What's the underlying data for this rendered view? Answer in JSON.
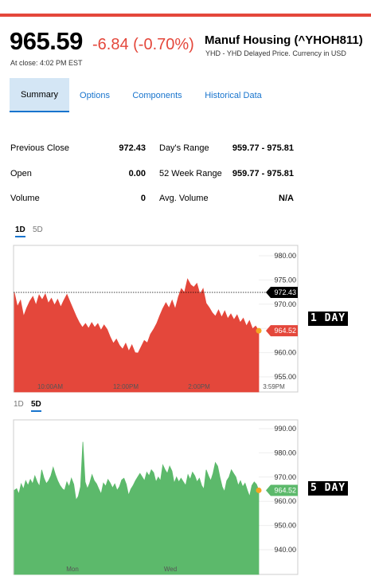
{
  "quote": {
    "price": "965.59",
    "change": "-6.84 (-0.70%)",
    "at_close": "At close: 4:02 PM EST",
    "name": "Manuf Housing (^YHOH811)",
    "subtitle": "YHD - YHD Delayed Price. Currency in USD"
  },
  "tabs": [
    "Summary",
    "Options",
    "Components",
    "Historical Data"
  ],
  "stats": [
    {
      "label": "Previous Close",
      "value": "972.43",
      "label2": "Day's Range",
      "value2": "959.77 - 975.81"
    },
    {
      "label": "Open",
      "value": "0.00",
      "label2": "52 Week Range",
      "value2": "959.77 - 975.81"
    },
    {
      "label": "Volume",
      "value": "0",
      "label2": "Avg. Volume",
      "value2": "N/A"
    }
  ],
  "chart1": {
    "range_tabs": [
      "1D",
      "5D"
    ],
    "side_label": "1 DAY"
  },
  "chart2": {
    "range_tabs": [
      "1D",
      "5D"
    ],
    "side_label": "5 DAY"
  },
  "colors": {
    "accent": "#1874cd",
    "down": "#e4473b",
    "up": "#5cb96b"
  },
  "chart_data": [
    {
      "type": "area",
      "title": "1D",
      "y_ticks": [
        "980.00",
        "975.00",
        "970.00",
        "965.00",
        "960.00",
        "955.00"
      ],
      "ylim": [
        955,
        980
      ],
      "x_ticks": [
        "10:00AM",
        "12:00PM",
        "2:00PM",
        "3:59PM"
      ],
      "reference_line": {
        "label": "972.43",
        "value": 972.43
      },
      "last_price": {
        "label": "964.52",
        "value": 964.52
      },
      "color": "#e4473b",
      "values": [
        972.4,
        969.5,
        970.8,
        967.5,
        969.2,
        970.6,
        971.6,
        969.8,
        971.9,
        970.9,
        972.1,
        970.2,
        971.2,
        969.8,
        971.0,
        969.4,
        970.8,
        972.0,
        970.5,
        969.0,
        967.5,
        966.2,
        965.2,
        966.0,
        965.0,
        966.2,
        965.2,
        966.0,
        964.6,
        965.7,
        964.8,
        963.2,
        961.9,
        962.8,
        961.5,
        960.7,
        961.9,
        960.3,
        961.6,
        960.0,
        959.9,
        961.2,
        962.5,
        962.0,
        963.8,
        964.8,
        966.0,
        967.6,
        969.1,
        970.3,
        969.2,
        970.8,
        969.0,
        971.5,
        973.2,
        972.4,
        975.2,
        974.0,
        973.5,
        974.3,
        972.0,
        973.2,
        970.2,
        969.3,
        968.2,
        967.5,
        968.8,
        967.3,
        968.6,
        967.0,
        968.0,
        966.8,
        967.8,
        966.2,
        967.1,
        965.5,
        966.6,
        964.9,
        965.5,
        964.52
      ]
    },
    {
      "type": "area",
      "title": "5D",
      "y_ticks": [
        "990.00",
        "980.00",
        "970.00",
        "960.00",
        "950.00",
        "940.00"
      ],
      "ylim": [
        940,
        990
      ],
      "x_ticks": [
        "Mon",
        "Wed"
      ],
      "last_price": {
        "label": "964.52",
        "value": 964.52
      },
      "color": "#5cb96b",
      "values": [
        964.5,
        965.2,
        963.0,
        967.2,
        965.0,
        968.5,
        966.5,
        969.0,
        967.2,
        970.5,
        968.0,
        966.2,
        973.0,
        969.5,
        967.3,
        968.5,
        970.5,
        974.0,
        971.0,
        968.5,
        966.5,
        965.2,
        964.5,
        968.0,
        966.0,
        969.5,
        967.0,
        960.5,
        962.0,
        966.0,
        984.5,
        968.0,
        965.2,
        967.5,
        971.0,
        968.5,
        967.2,
        965.0,
        963.0,
        967.5,
        966.2,
        969.0,
        967.5,
        965.5,
        967.2,
        964.5,
        966.0,
        968.8,
        969.5,
        967.0,
        962.5,
        965.0,
        966.5,
        968.5,
        970.0,
        971.5,
        970.0,
        968.5,
        972.0,
        970.5,
        973.0,
        971.8,
        968.0,
        970.0,
        968.5,
        975.0,
        973.0,
        971.5,
        974.5,
        972.5,
        967.5,
        970.0,
        968.0,
        969.5,
        968.0,
        966.5,
        971.0,
        969.0,
        972.0,
        970.5,
        968.0,
        969.5,
        966.5,
        965.0,
        973.0,
        970.5,
        968.5,
        971.5,
        976.0,
        974.5,
        970.0,
        966.0,
        964.0,
        968.5,
        970.0,
        973.0,
        971.5,
        970.0,
        966.5,
        968.5,
        966.0,
        967.5,
        964.5,
        962.0,
        966.5,
        968.0,
        967.0,
        964.52
      ]
    }
  ]
}
